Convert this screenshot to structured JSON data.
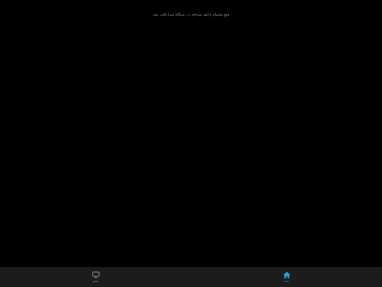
{
  "content": {
    "empty_message": "هیچ محتوای دانلود شده‌ای در دستگاه شما یافت نشد"
  },
  "bottom_nav": {
    "items": [
      {
        "label": "پخش",
        "icon": "tv-icon",
        "active": false
      },
      {
        "label": "خانه",
        "icon": "home-icon",
        "active": true
      }
    ]
  },
  "colors": {
    "background": "#000000",
    "nav_background": "#1c1c1c",
    "accent": "#22a7d8",
    "inactive": "#8a8a8a"
  }
}
